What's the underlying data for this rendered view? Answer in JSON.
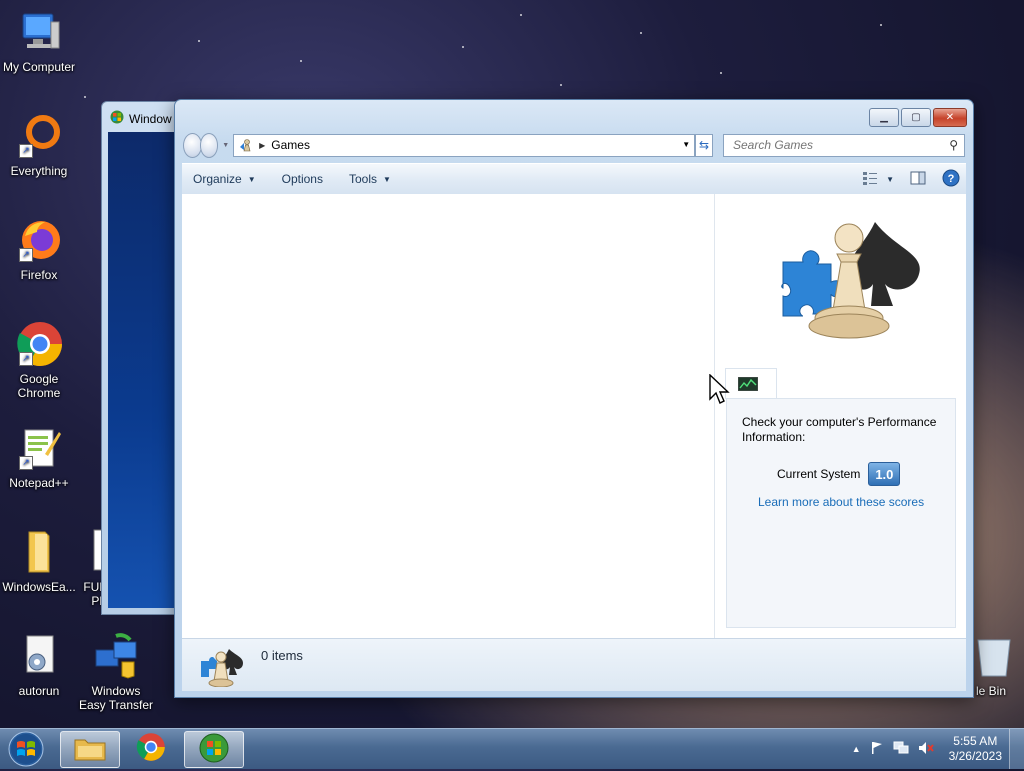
{
  "desktop": {
    "icons": [
      {
        "label": "My Computer"
      },
      {
        "label": "Everything"
      },
      {
        "label": "Firefox"
      },
      {
        "label": "Google Chrome"
      },
      {
        "label": "Notepad++"
      },
      {
        "label": "WindowsEa..."
      },
      {
        "label": "FUN PR"
      },
      {
        "label": "autorun"
      },
      {
        "label": "Windows Easy Transfer"
      },
      {
        "label": "le Bin"
      }
    ]
  },
  "background_window": {
    "title": "Window"
  },
  "explorer": {
    "address": {
      "crumb": "Games"
    },
    "search": {
      "placeholder": "Search Games"
    },
    "toolbar": {
      "organize": "Organize",
      "options": "Options",
      "tools": "Tools"
    },
    "details_pane": {
      "perf_title": "Check your computer's Performance Information:",
      "current_system_label": "Current System",
      "score": "1.0",
      "learn_more": "Learn more about these scores"
    },
    "status": {
      "items_text": "0 items"
    }
  },
  "taskbar": {
    "clock_time": "5:55 AM",
    "clock_date": "3/26/2023"
  },
  "colors": {
    "accent": "#1a6db8",
    "close_button": "#c6432a"
  }
}
